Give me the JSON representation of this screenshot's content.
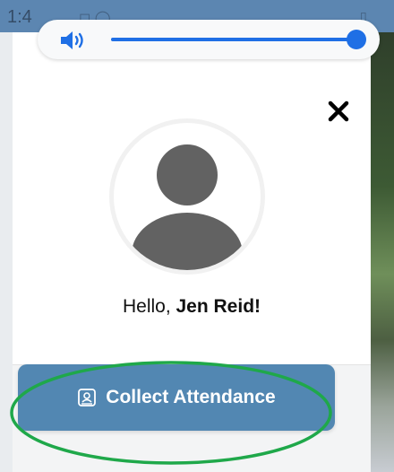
{
  "status_bar": {
    "time": "1:4",
    "icons": "◻ ◯",
    "right": "▯"
  },
  "volume": {
    "icon": "speaker-icon",
    "level": 0.98
  },
  "dialog": {
    "close_icon": "close-icon",
    "avatar_icon": "person-icon",
    "greeting_prefix": "Hello, ",
    "user_name": "Jen Reid!",
    "action_icon": "id-badge-icon",
    "action_label": "Collect Attendance"
  },
  "colors": {
    "accent": "#1f6fe5",
    "button": "#5287b2",
    "annotation": "#1fa84a"
  }
}
